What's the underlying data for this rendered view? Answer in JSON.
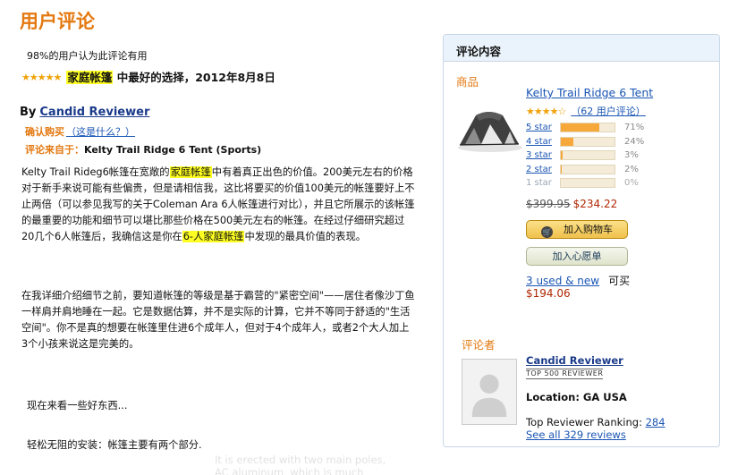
{
  "page": {
    "title": "用户评论"
  },
  "review": {
    "helpful": "98%的用户认为此评论有用",
    "stars": "★★★★★",
    "headline_highlight": "家庭帐篷",
    "headline_rest": "中最好的选择，2012年8月8日",
    "by_label": "By",
    "reviewer_name": "Candid Reviewer",
    "verified_label": "确认购买",
    "verified_link": "（这是什么？）",
    "from_label": "评论来自于：",
    "from_value": "Kelty Trail Ridge 6 Tent (Sports)",
    "p1_a": "Kelty Trail Rideg6帐篷在宽敞的",
    "p1_hl1": "家庭帐篷",
    "p1_b": "中有着真正出色的价值。200美元左右的价格对于新手来说可能有些偏贵，但是请相信我，这比将要买的价值100美元的帐篷要好上不止两倍（可以参见我写的关于Coleman Ara 6人帐篷进行对比），并且它所展示的该帐篷的最重要的功能和细节可以堪比那些价格在500美元左右的帐篷。在经过仔细研究超过20几个6人帐篷后，我确信这是你在",
    "p1_hl2": "6-人家庭帐篷",
    "p1_c": "中发现的最具价值的表现。",
    "p2": "在我详细介绍细节之前，要知道帐篷的等级是基于霸营的\"紧密空间\"——居住者像沙丁鱼一样肩并肩地睡在一起。它是数据估算，并不是实际的计算，它并不等同于舒适的\"生活空间\"。你不是真的想要在帐篷里住进6个成年人，但对于4个成年人，或者2个大人加上3个小孩来说这是完美的。",
    "p3": "现在来看一些好东西...",
    "p4": "轻松无阻的安装：帐篷主要有两个部分.",
    "ghost_line1": "It is erected with two main poles,",
    "ghost_line2": "AC aluminum, which is much"
  },
  "sidebar": {
    "header": "评论内容",
    "product_label": "商品",
    "product_title": "Kelty Trail Ridge 6 Tent",
    "product_stars": "★★★★☆",
    "review_count": "（62 用户评论）",
    "histogram": [
      {
        "label": "5 star",
        "pct": "71%",
        "value": 0.71
      },
      {
        "label": "4 star",
        "pct": "24%",
        "value": 0.24
      },
      {
        "label": "3 star",
        "pct": "3%",
        "value": 0.03
      },
      {
        "label": "2 star",
        "pct": "2%",
        "value": 0.02
      },
      {
        "label": "1 star",
        "pct": "0%",
        "value": 0
      }
    ],
    "price_old": "$399.95",
    "price_new": "$234.22",
    "cart_button": "加入购物车",
    "wish_button": "加入心愿单",
    "used_link": "3 used & new",
    "used_suffix": "可买",
    "used_price": "$194.06",
    "reviewer_label": "评论者",
    "reviewer_name": "Candid Reviewer",
    "reviewer_badge": "TOP 500 REVIEWER",
    "location": "Location: GA USA",
    "rank_label": "Top Reviewer Ranking:",
    "rank_value": "284",
    "see_all": "See all 329 reviews"
  }
}
